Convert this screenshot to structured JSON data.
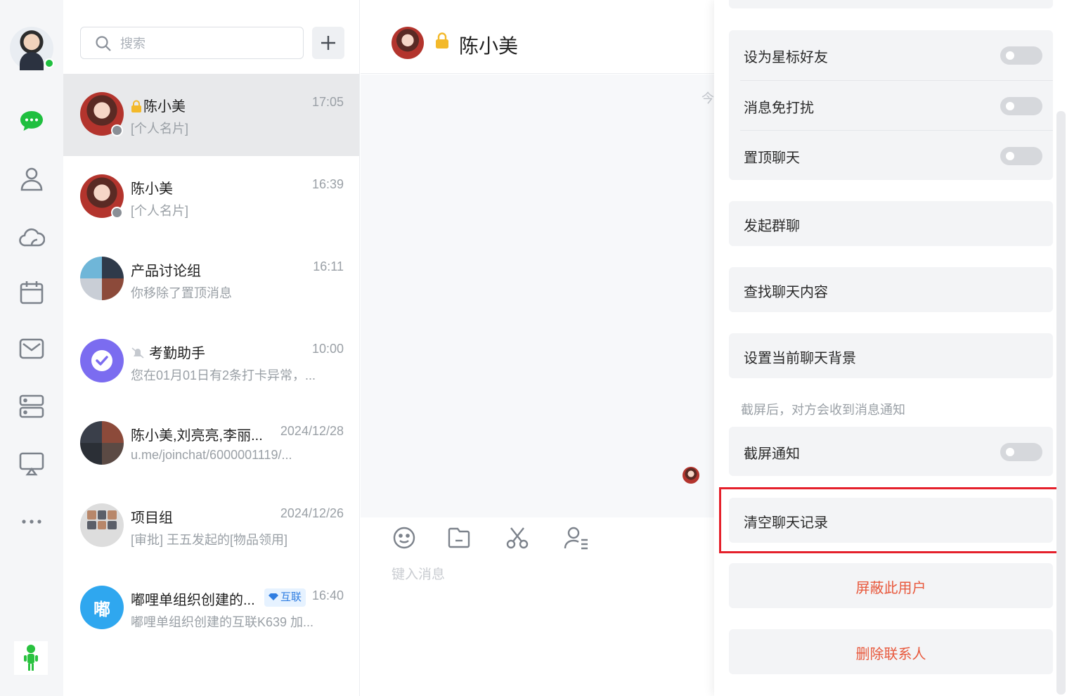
{
  "search": {
    "placeholder": "搜索"
  },
  "conversations": [
    {
      "name": "陈小美",
      "time": "17:05",
      "preview": "[个人名片]",
      "locked": true,
      "active": true
    },
    {
      "name": "陈小美",
      "time": "16:39",
      "preview": "[个人名片]"
    },
    {
      "name": "产品讨论组",
      "time": "16:11",
      "preview": "你移除了置顶消息"
    },
    {
      "name": "考勤助手",
      "time": "10:00",
      "preview": "您在01月01日有2条打卡异常，..."
    },
    {
      "name": "陈小美,刘亮亮,李丽...",
      "time": "2024/12/28",
      "preview": "u.me/joinchat/6000001119/..."
    },
    {
      "name": "项目组",
      "time": "2024/12/26",
      "preview": "[审批] 王五发起的[物品领用]"
    },
    {
      "name": "嘟哩单组织创建的...",
      "time": "16:40",
      "preview": "嘟哩单组织创建的互联K639 加...",
      "tag": "互联",
      "avatar_text": "嘟"
    }
  ],
  "chat": {
    "title": "陈小美",
    "date_fragment": "今",
    "input_placeholder": "键入消息"
  },
  "settings": {
    "toggle_rows": [
      {
        "label": "设为星标好友",
        "on": false
      },
      {
        "label": "消息免打扰",
        "on": false
      },
      {
        "label": "置顶聊天",
        "on": false
      }
    ],
    "start_group": "发起群聊",
    "search_history": "查找聊天内容",
    "set_background": "设置当前聊天背景",
    "screenshot_hint": "截屏后，对方会收到消息通知",
    "screenshot_notify": {
      "label": "截屏通知",
      "on": false
    },
    "clear_history": "清空聊天记录",
    "block_user": "屏蔽此用户",
    "delete_contact": "删除联系人"
  },
  "colors": {
    "accent_green": "#1fbf3f",
    "danger": "#e8583c",
    "highlight": "#e5202b",
    "tag_blue": "#2f7de1"
  }
}
